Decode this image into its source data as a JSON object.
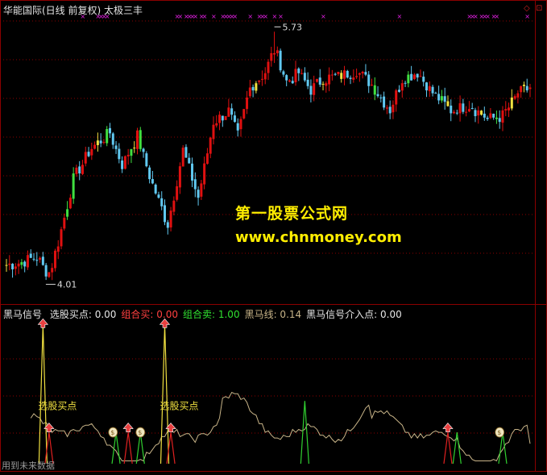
{
  "header": {
    "title": "华能国际(日线 前复权) 太极三丰"
  },
  "indicator": {
    "name": "黑马信号",
    "items": [
      {
        "label": "选股买点:",
        "value": "0.00",
        "color": "#e6e6e6"
      },
      {
        "label": "组合买:",
        "value": "0.00",
        "color": "#ff4040"
      },
      {
        "label": "组合卖:",
        "value": "1.00",
        "color": "#30e030"
      },
      {
        "label": "黑马线:",
        "value": "0.14",
        "color": "#c8b488"
      },
      {
        "label": "黑马信号介入点:",
        "value": "0.00",
        "color": "#e6e6e6"
      }
    ]
  },
  "watermark": {
    "line1": "第一股票公式网",
    "line2": "www.chnmoney.com"
  },
  "footer": {
    "text": "用到未来数据"
  },
  "colors": {
    "up": "#e01010",
    "down": "#60c8f0",
    "bar_green": "#40e040",
    "bar_yellow": "#f0e040",
    "grid": "#8b0000",
    "marker": "#e020e0",
    "ind_line": "#c8b488",
    "buy_spike": "#f0e040",
    "red_spike": "#e02020",
    "green_spike": "#30d030"
  },
  "chart_data": [
    {
      "type": "candlestick",
      "title": "华能国际(日线 前复权) 太极三丰",
      "ylim": [
        3.85,
        5.85
      ],
      "annotations": [
        {
          "text": "5.73",
          "kind": "high",
          "index": 88,
          "value": 5.73
        },
        {
          "text": "4.01",
          "kind": "low",
          "index": 14,
          "value": 4.01
        }
      ],
      "series": [
        {
          "name": "price",
          "values": []
        }
      ]
    },
    {
      "type": "line",
      "title": "黑马信号",
      "ylim": [
        0,
        1
      ],
      "labels": [
        {
          "text": "选股买点",
          "index": 12
        },
        {
          "text": "选股买点",
          "index": 52
        }
      ],
      "series": [
        {
          "name": "黑马线",
          "values": []
        },
        {
          "name": "选股买点",
          "spikes": [
            12,
            52
          ]
        },
        {
          "name": "组合买",
          "spikes": [
            14,
            40,
            54,
            145
          ]
        },
        {
          "name": "组合卖",
          "spikes": [
            36,
            44,
            98,
            148,
            163
          ]
        },
        {
          "name": "黑马信号介入点",
          "markers": [
            35,
            44,
            162
          ]
        }
      ]
    }
  ]
}
